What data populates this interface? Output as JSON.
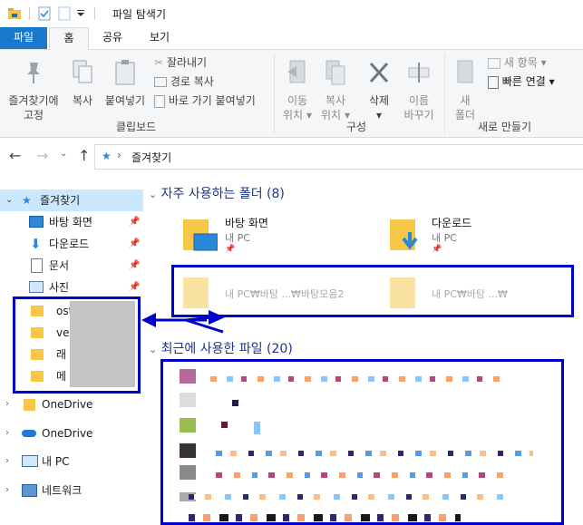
{
  "window": {
    "title": "파일 탐색기"
  },
  "tabs": [
    {
      "label": "파일"
    },
    {
      "label": "홈"
    },
    {
      "label": "공유"
    },
    {
      "label": "보기"
    }
  ],
  "ribbon": {
    "clipboard": {
      "pin_label_1": "즐겨찾기에",
      "pin_label_2": "고정",
      "copy_label": "복사",
      "paste_label": "붙여넣기",
      "cut_label": "잘라내기",
      "copy_path_label": "경로 복사",
      "paste_shortcut_label": "바로 가기 붙여넣기",
      "group_label": "클립보드"
    },
    "organize": {
      "move_label_1": "이동",
      "move_label_2": "위치",
      "copyto_label_1": "복사",
      "copyto_label_2": "위치",
      "delete_label": "삭제",
      "rename_label_1": "이름",
      "rename_label_2": "바꾸기",
      "group_label": "구성"
    },
    "new": {
      "new_folder_label_1": "새",
      "new_folder_label_2": "폴더",
      "new_item_label": "새 항목",
      "easy_access_label": "빠른 연결",
      "group_label": "새로 만들기"
    }
  },
  "address": {
    "path": "즐겨찾기"
  },
  "nav": {
    "quick_access": "즐겨찾기",
    "items": [
      {
        "label": "바탕 화면"
      },
      {
        "label": "다운로드"
      },
      {
        "label": "문서"
      },
      {
        "label": "사진"
      }
    ],
    "blurred_items": [
      "ost",
      "veb",
      "래",
      "메"
    ],
    "onedrive_1": "OneDrive",
    "onedrive_2": "OneDrive",
    "this_pc": "내 PC",
    "network": "네트워크"
  },
  "content": {
    "frequent_header": "자주 사용하는 폴더 (8)",
    "frequent": [
      {
        "name": "바탕 화면",
        "location": "내 PC"
      },
      {
        "name": "다운로드",
        "location": "내 PC"
      }
    ],
    "frequent_hidden": [
      {
        "location": "내 PC₩바탕 ...₩바탕모음2"
      },
      {
        "location": "내 PC₩바탕 ...₩"
      }
    ],
    "recent_header": "최근에 사용한 파일 (20)"
  },
  "colors": {
    "accent": "#1979ca",
    "annotation": "#0000cc",
    "selected": "#cce8ff",
    "folder": "#f6c747"
  }
}
